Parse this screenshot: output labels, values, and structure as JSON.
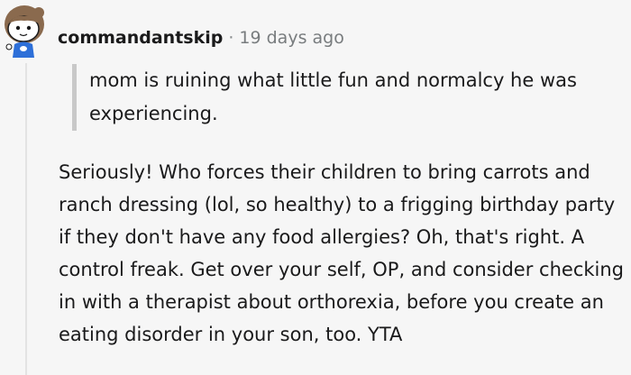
{
  "comment": {
    "author": "commandantskip",
    "separator": "·",
    "timestamp": "19 days ago",
    "quote": "mom is ruining what little fun and normalcy he was experiencing.",
    "body": "Seriously! Who forces their children to bring carrots and ranch dressing (lol, so healthy) to a frigging birthday party if they don't have any food allergies? Oh, that's right. A control freak. Get over your self, OP, and consider checking in with a therapist about orthorexia, before you create an eating disorder in your son, too. YTA"
  },
  "avatar": {
    "icon": "snoo-avatar-icon",
    "hair_color": "#8a6a4e",
    "shirt_color": "#2d6fd8"
  },
  "colors": {
    "background": "#f6f6f6",
    "text": "#1a1a1b",
    "muted": "#787c7e",
    "quote_bar": "#c8c8c8"
  }
}
